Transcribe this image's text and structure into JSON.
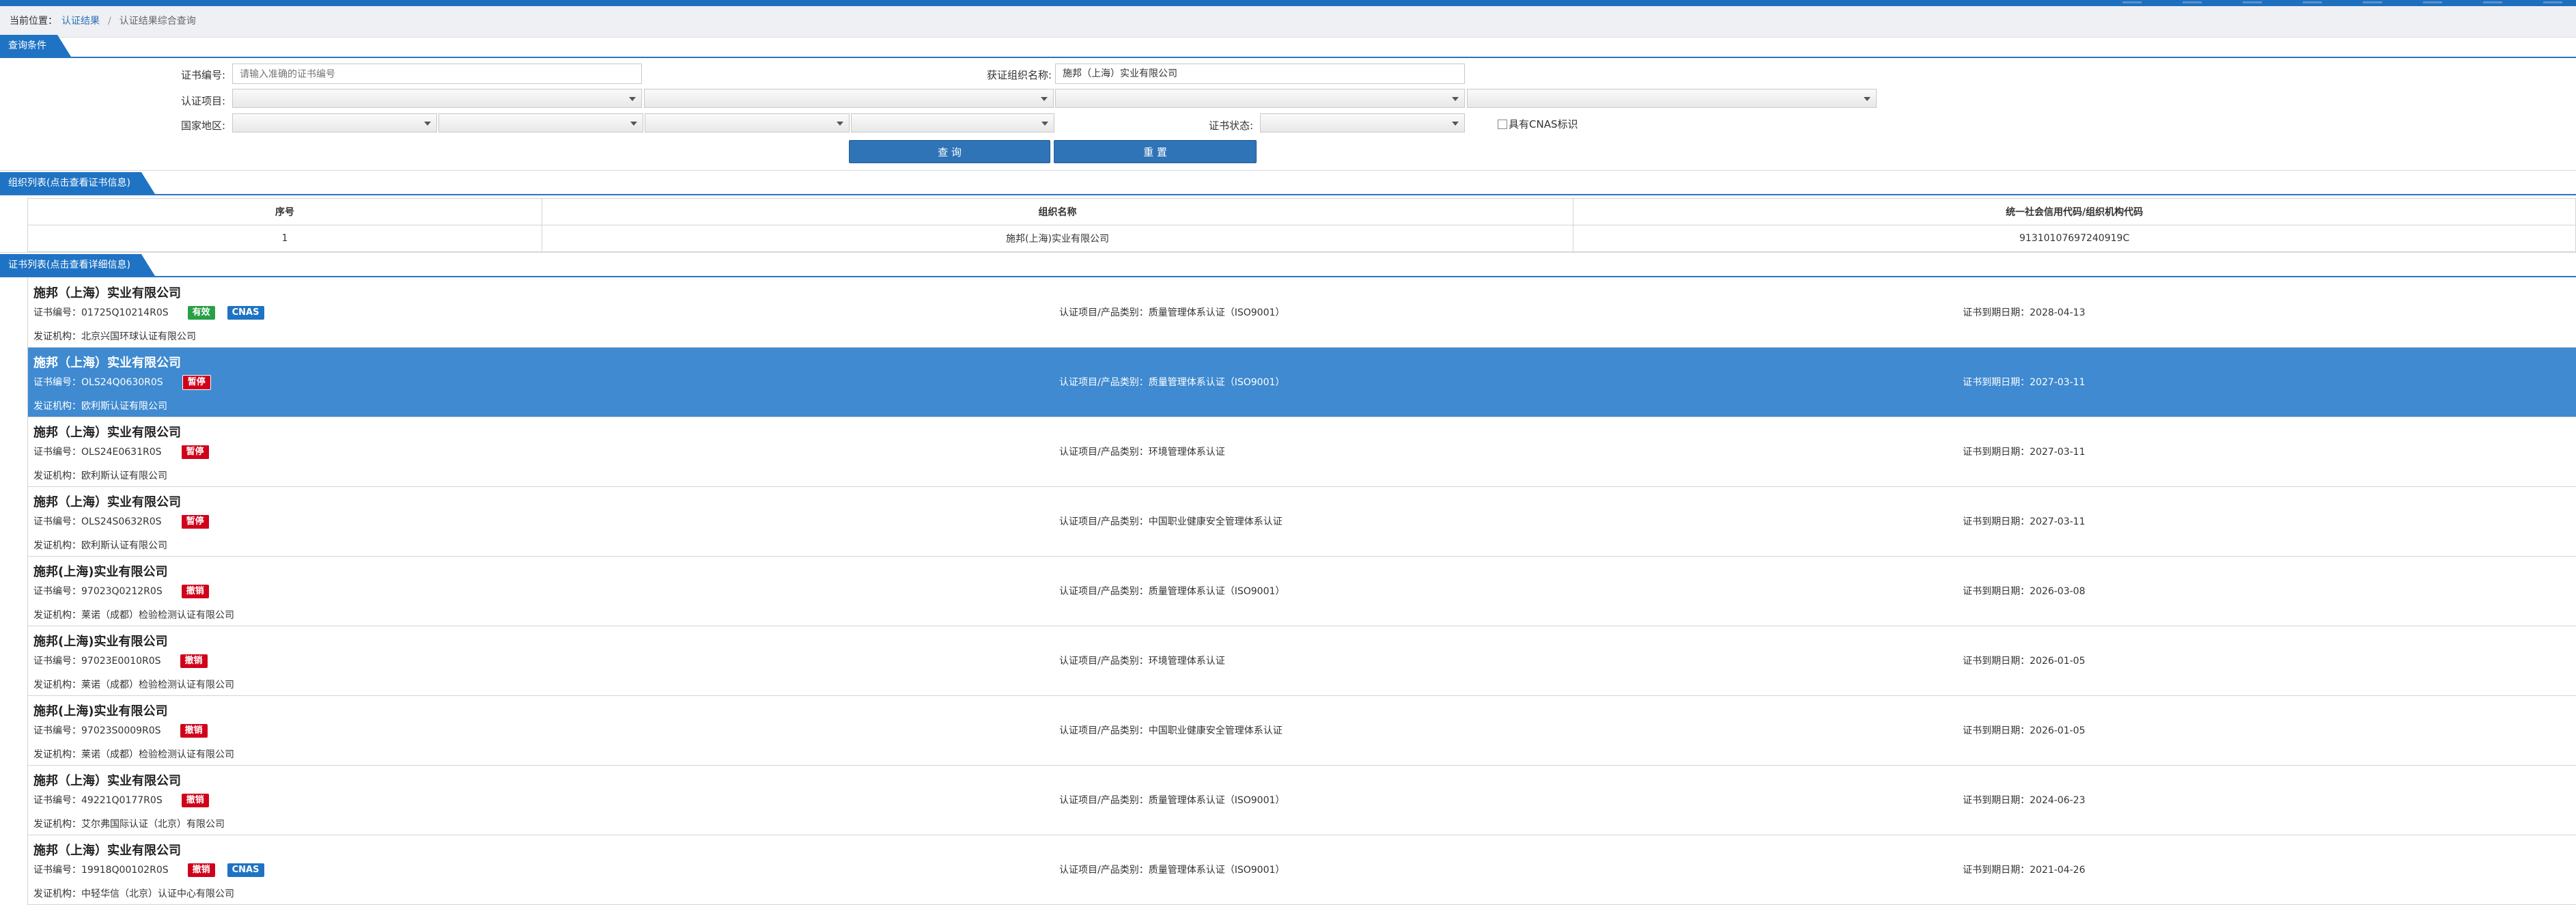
{
  "breadcrumb": {
    "prefix": "当前位置：",
    "item1": "认证结果",
    "sep": "/",
    "item2": "认证结果综合查询"
  },
  "query": {
    "section_title": "查询条件",
    "cert_no_label": "证书编号:",
    "cert_no_placeholder": "请输入准确的证书编号",
    "org_name_label": "获证组织名称:",
    "org_name_value": "施邦（上海）实业有限公司",
    "project_label": "认证项目:",
    "region_label": "国家地区:",
    "status_label": "证书状态:",
    "cnas_label": "具有CNAS标识",
    "search_button": "查 询",
    "reset_button": "重 置"
  },
  "org_list": {
    "section_title": "组织列表(点击查看证书信息)",
    "headers": [
      "序号",
      "组织名称",
      "统一社会信用代码/组织机构代码"
    ],
    "rows": [
      [
        "1",
        "施邦(上海)实业有限公司",
        "91310107697240919C"
      ]
    ]
  },
  "cert_list": {
    "section_title": "证书列表(点击查看详细信息)",
    "cert_no_prefix": "证书编号：",
    "product_prefix": "认证项目/产品类别：",
    "expiry_prefix": "证书到期日期：",
    "issuer_prefix": "发证机构：",
    "items": [
      {
        "org": "施邦（上海）实业有限公司",
        "cert_no": "01725Q10214R0S",
        "status": "有效",
        "status_kind": "valid",
        "cnas": "CNAS",
        "product": "质量管理体系认证（ISO9001）",
        "expiry": "2028-04-13",
        "issuer": "北京兴国环球认证有限公司"
      },
      {
        "org": "施邦（上海）实业有限公司",
        "cert_no": "OLS24Q0630R0S",
        "status": "暂停",
        "status_kind": "suspended",
        "cnas": "",
        "product": "质量管理体系认证（ISO9001）",
        "expiry": "2027-03-11",
        "issuer": "欧利斯认证有限公司"
      },
      {
        "org": "施邦（上海）实业有限公司",
        "cert_no": "OLS24E0631R0S",
        "status": "暂停",
        "status_kind": "suspended",
        "cnas": "",
        "product": "环境管理体系认证",
        "expiry": "2027-03-11",
        "issuer": "欧利斯认证有限公司"
      },
      {
        "org": "施邦（上海）实业有限公司",
        "cert_no": "OLS24S0632R0S",
        "status": "暂停",
        "status_kind": "suspended",
        "cnas": "",
        "product": "中国职业健康安全管理体系认证",
        "expiry": "2027-03-11",
        "issuer": "欧利斯认证有限公司"
      },
      {
        "org": "施邦(上海)实业有限公司",
        "cert_no": "97023Q0212R0S",
        "status": "撤销",
        "status_kind": "revoked",
        "cnas": "",
        "product": "质量管理体系认证（ISO9001）",
        "expiry": "2026-03-08",
        "issuer": "莱诺（成都）检验检测认证有限公司"
      },
      {
        "org": "施邦(上海)实业有限公司",
        "cert_no": "97023E0010R0S",
        "status": "撤销",
        "status_kind": "revoked",
        "cnas": "",
        "product": "环境管理体系认证",
        "expiry": "2026-01-05",
        "issuer": "莱诺（成都）检验检测认证有限公司"
      },
      {
        "org": "施邦(上海)实业有限公司",
        "cert_no": "97023S0009R0S",
        "status": "撤销",
        "status_kind": "revoked",
        "cnas": "",
        "product": "中国职业健康安全管理体系认证",
        "expiry": "2026-01-05",
        "issuer": "莱诺（成都）检验检测认证有限公司"
      },
      {
        "org": "施邦（上海）实业有限公司",
        "cert_no": "49221Q0177R0S",
        "status": "撤销",
        "status_kind": "revoked",
        "cnas": "",
        "product": "质量管理体系认证（ISO9001）",
        "expiry": "2024-06-23",
        "issuer": "艾尔弗国际认证（北京）有限公司"
      },
      {
        "org": "施邦（上海）实业有限公司",
        "cert_no": "19918Q00102R0S",
        "status": "撤销",
        "status_kind": "revoked",
        "cnas": "CNAS",
        "product": "质量管理体系认证（ISO9001）",
        "expiry": "2021-04-26",
        "issuer": "中轻华信（北京）认证中心有限公司"
      }
    ]
  },
  "colors": {
    "brand": "#1f6fbf",
    "selected_row": "#3f8ad0",
    "valid": "#27a046",
    "revoked": "#d0021b",
    "cnas": "#1f73c4"
  }
}
